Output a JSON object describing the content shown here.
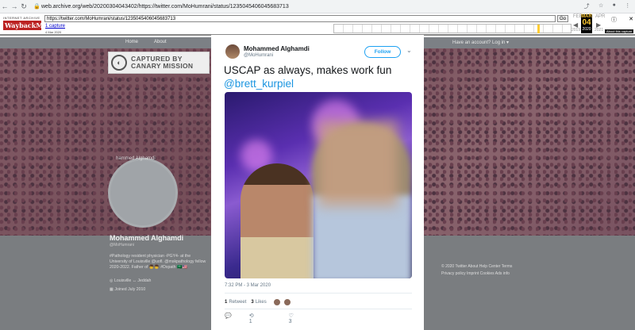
{
  "browser": {
    "back": "←",
    "forward": "→",
    "reload": "↻",
    "url": "web.archive.org/web/20200304043402/https://twitter.com/MoHumrani/status/1235045406045683713",
    "icons": [
      "share-icon",
      "star-icon",
      "account-icon",
      "menu-icon"
    ]
  },
  "wayback": {
    "logo_top": "INTERNET ARCHIVE",
    "logo_main": "WaybackMachine",
    "url_field": "https://twitter.com/MoHumrani/status/1235045406045683713",
    "go_label": "Go",
    "captures_link": "1 capture",
    "captures_date": "4 Mar 2020",
    "prev_month": "FEB",
    "cur_month": "MAR",
    "cur_day": "04",
    "cur_year": "2020",
    "next_month": "APR",
    "prev_year": "2019",
    "next_year": "2021",
    "about": "About this capture"
  },
  "twitter": {
    "nav_home": "Home",
    "nav_about": "About",
    "account": "Have an account? Log in ▾",
    "watermark": [
      "CAPTURED BY",
      "CANARY MISSION"
    ],
    "faint_name": "hammed Alghamdi",
    "profile_name": "Mohammed Alghamdi",
    "profile_handle": "@MoHumrani",
    "bio": "#Pathology resident physician -PGY4- at the University of Louisville @uofl. @mskpathology fellow 2020-2022. Father of 👦👦 #Dxpath 🇸🇦🇺🇸",
    "location": "Louisville ↔ Jeddah",
    "joined": "Joined July 2010",
    "footer": [
      "© 2020 Twitter  About  Help Center  Terms",
      "Privacy policy  Imprint  Cookies  Ads info"
    ]
  },
  "tweet": {
    "author_name": "Mohammed Alghamdi",
    "author_handle": "@MoHumrani",
    "follow_label": "Follow",
    "text": "USCAP as always, makes work fun ",
    "mention": "@brett_kurpiel",
    "timestamp": "7:32 PM - 3 Mar 2020",
    "retweets_count": "1",
    "retweets_label": "Retweet",
    "likes_count": "3",
    "likes_label": "Likes",
    "reply_count": "",
    "rt_action_count": "1",
    "like_action_count": "3"
  }
}
